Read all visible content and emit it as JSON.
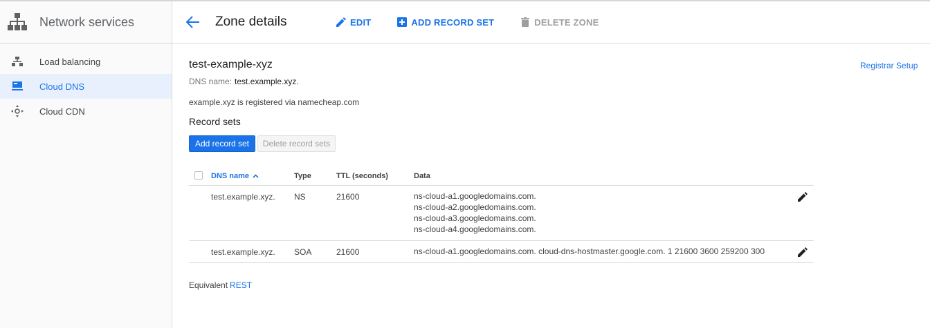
{
  "sidebar": {
    "title": "Network services",
    "items": [
      {
        "label": "Load balancing",
        "icon": "load-balancing-icon",
        "active": false
      },
      {
        "label": "Cloud DNS",
        "icon": "cloud-dns-icon",
        "active": true
      },
      {
        "label": "Cloud CDN",
        "icon": "cloud-cdn-icon",
        "active": false
      }
    ]
  },
  "header": {
    "title": "Zone details",
    "edit_label": "EDIT",
    "add_record_set_label": "ADD RECORD SET",
    "delete_zone_label": "DELETE ZONE"
  },
  "zone": {
    "name": "test-example-xyz",
    "dns_name_label": "DNS name:",
    "dns_name_value": "test.example.xyz.",
    "registered_text": "example.xyz is registered via namecheap.com",
    "registrar_setup_label": "Registrar Setup"
  },
  "record_sets": {
    "title": "Record sets",
    "add_button": "Add record set",
    "delete_button": "Delete record sets",
    "columns": {
      "dns_name": "DNS name",
      "type": "Type",
      "ttl": "TTL (seconds)",
      "data": "Data"
    },
    "rows": [
      {
        "dns_name": "test.example.xyz.",
        "type": "NS",
        "ttl": "21600",
        "data": [
          "ns-cloud-a1.googledomains.com.",
          "ns-cloud-a2.googledomains.com.",
          "ns-cloud-a3.googledomains.com.",
          "ns-cloud-a4.googledomains.com."
        ]
      },
      {
        "dns_name": "test.example.xyz.",
        "type": "SOA",
        "ttl": "21600",
        "data": [
          "ns-cloud-a1.googledomains.com. cloud-dns-hostmaster.google.com. 1 21600 3600 259200 300"
        ]
      }
    ]
  },
  "footer": {
    "equivalent_label": "Equivalent",
    "rest_link": "REST"
  },
  "colors": {
    "accent": "#1a73e8",
    "active_bg": "#e8f0fe",
    "sidebar_bg": "#fafafa",
    "divider": "#dadada"
  }
}
